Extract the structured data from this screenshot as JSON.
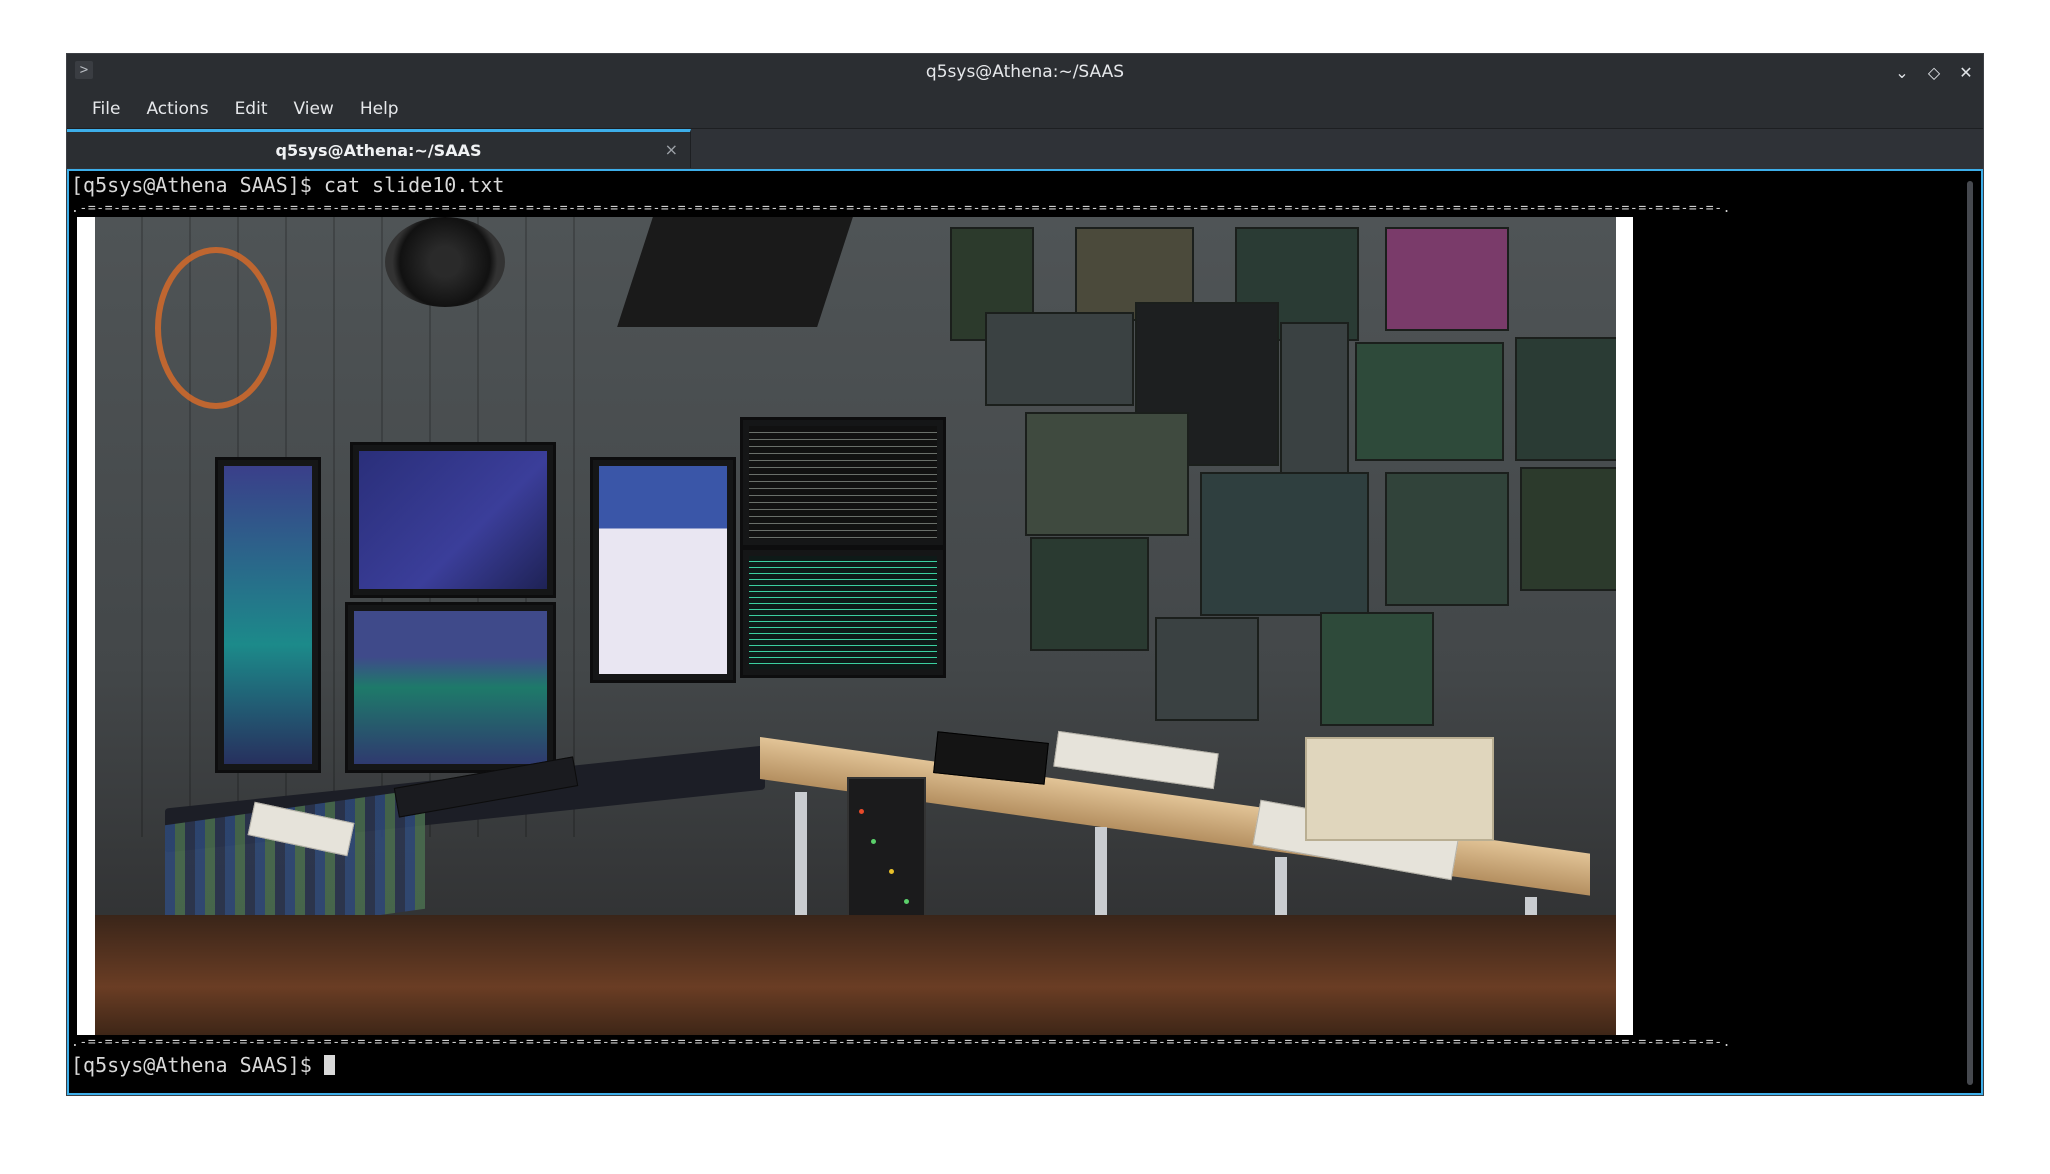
{
  "window": {
    "title": "q5sys@Athena:~/SAAS",
    "app_icon_glyph": ">",
    "controls": {
      "minimize_glyph": "⌄",
      "maximize_glyph": "◇",
      "close_glyph": "✕"
    }
  },
  "menu": {
    "items": [
      {
        "label": "File"
      },
      {
        "label": "Actions"
      },
      {
        "label": "Edit"
      },
      {
        "label": "View"
      },
      {
        "label": "Help"
      }
    ]
  },
  "tabs": [
    {
      "label": "q5sys@Athena:~/SAAS",
      "close_glyph": "×",
      "active": true
    }
  ],
  "terminal": {
    "command_line": "[q5sys@Athena SAAS]$ cat slide10.txt",
    "border_top": ".-=-=-=-=-=-=-=-=-=-=-=-=-=-=-=-=-=-=-=-=-=-=-=-=-=-=-=-=-=-=-=-=-=-=-=-=-=-=-=-=-=-=-=-=-=-=-=-=-=-=-=-=-=-=-=-=-=-=-=-=-=-=-=-=-=-=-=-=-=-=-=-=-=-=-=-=-=-=-=-=-=-=-=-=-=-=-=-=-=-=-=-=-=-=-=-=-=-.",
    "border_bottom": ".-=-=-=-=-=-=-=-=-=-=-=-=-=-=-=-=-=-=-=-=-=-=-=-=-=-=-=-=-=-=-=-=-=-=-=-=-=-=-=-=-=-=-=-=-=-=-=-=-=-=-=-=-=-=-=-=-=-=-=-=-=-=-=-=-=-=-=-=-=-=-=-=-=-=-=-=-=-=-=-=-=-=-=-=-=-=-=-=-=-=-=-=-=-=-=-=-=-.",
    "prompt": "[q5sys@Athena SAAS]$ "
  },
  "colors": {
    "accent": "#3daee9",
    "chrome": "#2b2e32",
    "terminal_bg": "#000000",
    "terminal_fg": "#d9d9d9"
  }
}
